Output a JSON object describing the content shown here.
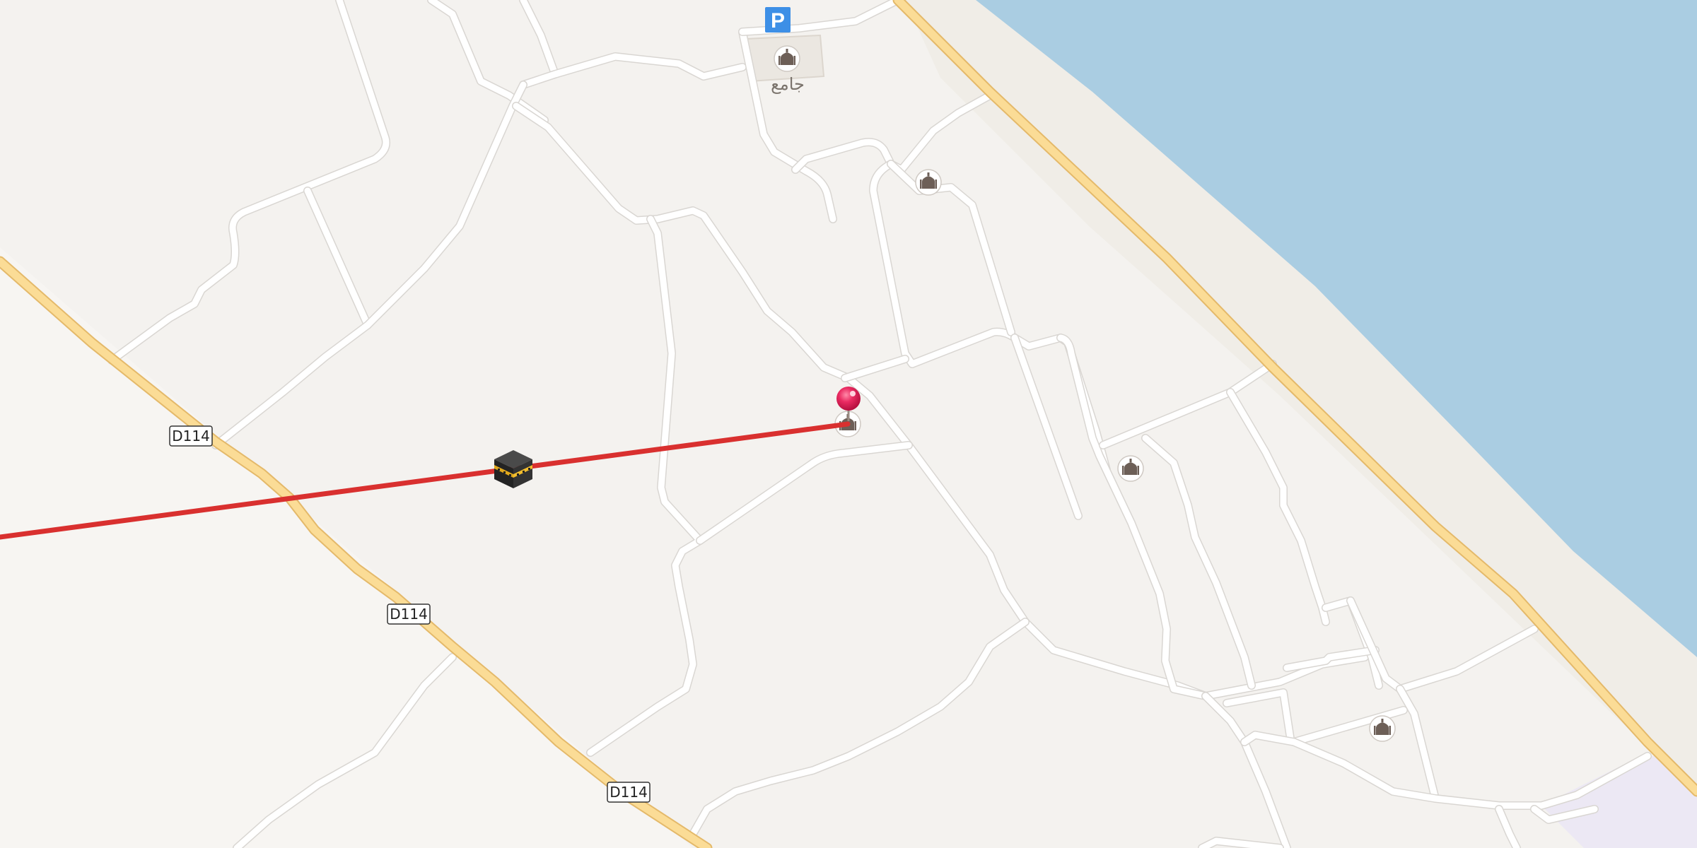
{
  "map": {
    "road_shields": [
      "D114",
      "D114",
      "D114"
    ],
    "poi_labels": {
      "mosque_north_name": "جامع"
    },
    "parking_symbol": "P",
    "icons": {
      "mosque": "mosque-icon",
      "parking": "parking-icon",
      "kaaba": "kaaba-icon",
      "location_pin": "location-pin-icon",
      "qibla_line": "qibla-direction-line"
    },
    "colors": {
      "land": "#f4f2ef",
      "water": "#aacde2",
      "beach": "#f1eee8",
      "highway": "#fbdc96",
      "minor_road": "#ffffff",
      "qibla_line": "#d9302f",
      "pin": "#e8235b",
      "parking": "#3d8fe6",
      "zone": "#ece8f4",
      "poi_icon": "#6d5f57"
    }
  }
}
